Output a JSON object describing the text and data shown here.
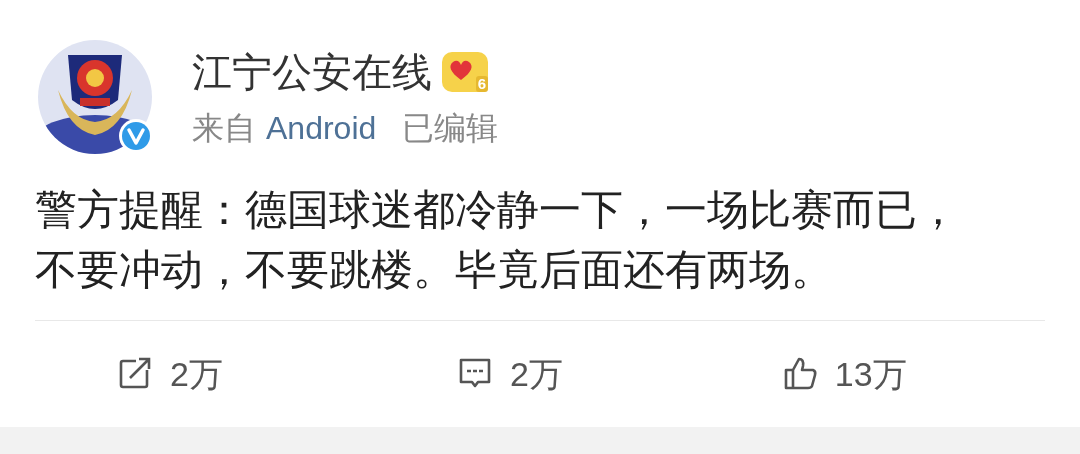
{
  "post": {
    "author": "江宁公安在线",
    "member_level": "6",
    "verified": true,
    "source_prefix": "来自",
    "source": "Android",
    "edited": "已编辑",
    "body": "警方提醒：德国球迷都冷静一下，一场比赛而已，不要冲动，不要跳楼。毕竟后面还有两场。"
  },
  "actions": [
    {
      "kind": "repost",
      "count": "2万"
    },
    {
      "kind": "comment",
      "count": "2万"
    },
    {
      "kind": "like",
      "count": "13万"
    }
  ]
}
